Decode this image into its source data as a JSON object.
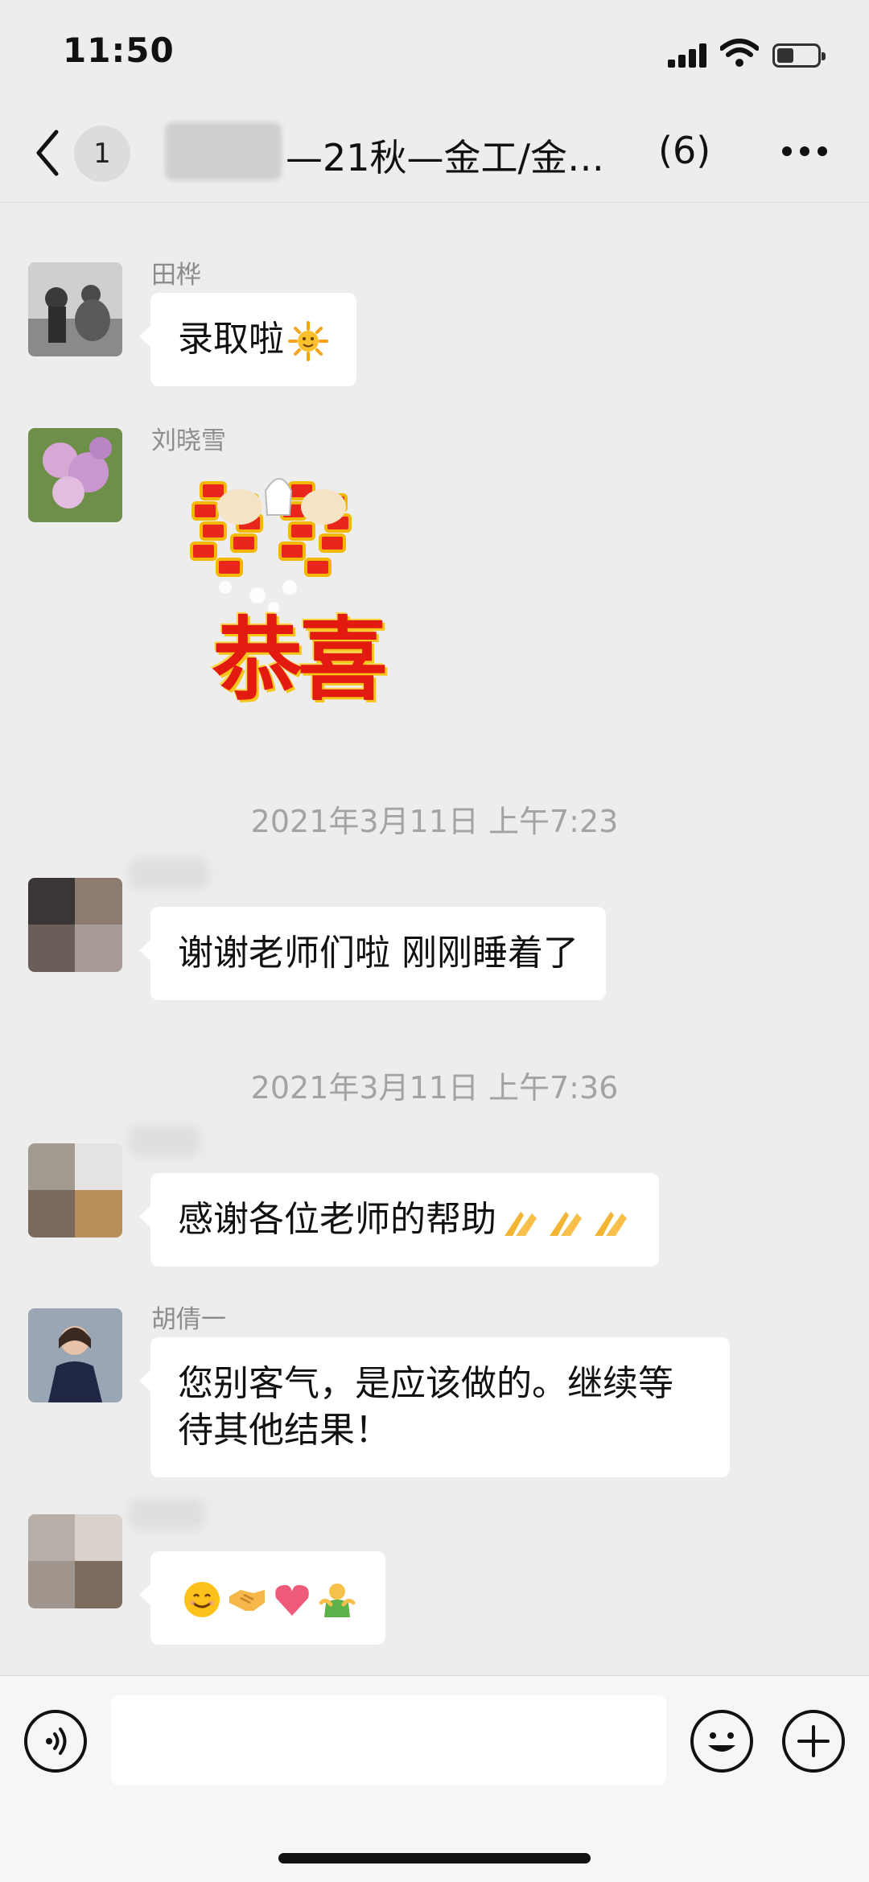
{
  "status_bar": {
    "time": "11:50",
    "icons": [
      "signal-icon",
      "wifi-icon",
      "battery-icon"
    ]
  },
  "nav": {
    "back_icon": "chevron-left-icon",
    "unread_count": "1",
    "title": "—21秋—金工/金…",
    "member_count": "(6)",
    "more_icon": "more-icon"
  },
  "messages": [
    {
      "type": "text",
      "sender": "田桦",
      "text": "录取啦",
      "emoji": "sun-emoji"
    },
    {
      "type": "sticker",
      "sender": "刘晓雪",
      "sticker_text": "恭喜"
    },
    {
      "type": "timestamp",
      "text": "2021年3月11日 上午7:23"
    },
    {
      "type": "text",
      "sender": "",
      "text": "谢谢老师们啦 刚刚睡着了"
    },
    {
      "type": "timestamp",
      "text": "2021年3月11日 上午7:36"
    },
    {
      "type": "text",
      "sender": "",
      "text": "感谢各位老师的帮助",
      "emoji": "praying-hands-emoji x3"
    },
    {
      "type": "text",
      "sender": "胡倩一",
      "text": "您别客气，是应该做的。继续等待其他结果！"
    },
    {
      "type": "text",
      "sender": "",
      "text": "",
      "emoji": "smile, handshake, heart, hug emojis"
    }
  ],
  "input_bar": {
    "voice_icon": "voice-icon",
    "emoji_icon": "smiley-icon",
    "plus_icon": "plus-icon",
    "input_value": ""
  },
  "colors": {
    "background": "#ededed",
    "bubble": "#ffffff",
    "timestamp": "#a3a3a3",
    "sender_name": "#8d8d8d",
    "sticker_red": "#e21a10",
    "sticker_gold": "#f6c518"
  }
}
